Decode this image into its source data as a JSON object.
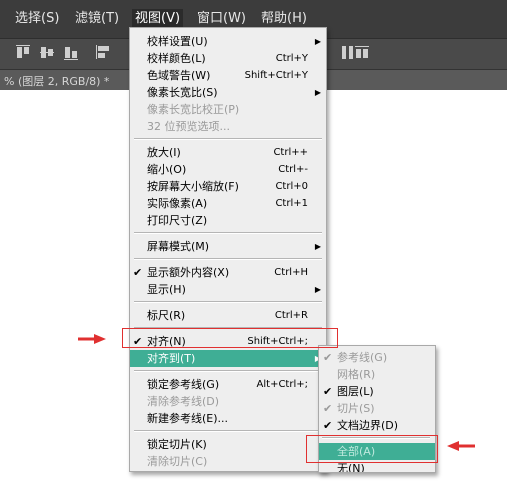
{
  "menubar": {
    "items": [
      {
        "label": "选择(S)"
      },
      {
        "label": "滤镜(T)"
      },
      {
        "label": "视图(V)"
      },
      {
        "label": "窗口(W)"
      },
      {
        "label": "帮助(H)"
      }
    ]
  },
  "document": {
    "tab_title": "% (图层 2, RGB/8) *"
  },
  "view_menu": {
    "items": [
      {
        "label": "校样设置(U)",
        "shortcut": "",
        "submenu": true
      },
      {
        "label": "校样颜色(L)",
        "shortcut": "Ctrl+Y"
      },
      {
        "label": "色域警告(W)",
        "shortcut": "Shift+Ctrl+Y"
      },
      {
        "label": "像素长宽比(S)",
        "shortcut": "",
        "submenu": true
      },
      {
        "label": "像素长宽比校正(P)",
        "shortcut": "",
        "disabled": true
      },
      {
        "label": "32 位预览选项...",
        "shortcut": "",
        "disabled": true
      },
      {
        "label": "放大(I)",
        "shortcut": "Ctrl++"
      },
      {
        "label": "缩小(O)",
        "shortcut": "Ctrl+-"
      },
      {
        "label": "按屏幕大小缩放(F)",
        "shortcut": "Ctrl+0"
      },
      {
        "label": "实际像素(A)",
        "shortcut": "Ctrl+1"
      },
      {
        "label": "打印尺寸(Z)",
        "shortcut": ""
      },
      {
        "label": "屏幕模式(M)",
        "shortcut": "",
        "submenu": true
      },
      {
        "label": "显示额外内容(X)",
        "shortcut": "Ctrl+H",
        "checked": true
      },
      {
        "label": "显示(H)",
        "shortcut": "",
        "submenu": true
      },
      {
        "label": "标尺(R)",
        "shortcut": "Ctrl+R"
      },
      {
        "label": "对齐(N)",
        "shortcut": "Shift+Ctrl+;",
        "checked": true
      },
      {
        "label": "对齐到(T)",
        "shortcut": "",
        "submenu": true,
        "highlighted": true
      },
      {
        "label": "锁定参考线(G)",
        "shortcut": "Alt+Ctrl+;"
      },
      {
        "label": "清除参考线(D)",
        "shortcut": "",
        "disabled": true
      },
      {
        "label": "新建参考线(E)...",
        "shortcut": ""
      },
      {
        "label": "锁定切片(K)",
        "shortcut": ""
      },
      {
        "label": "清除切片(C)",
        "shortcut": "",
        "disabled": true
      }
    ]
  },
  "snap_to_submenu": {
    "items": [
      {
        "label": "参考线(G)",
        "checked": true,
        "disabled": true
      },
      {
        "label": "网格(R)",
        "checked": false,
        "disabled": true
      },
      {
        "label": "图层(L)",
        "checked": true,
        "disabled": false
      },
      {
        "label": "切片(S)",
        "checked": true,
        "disabled": true
      },
      {
        "label": "文档边界(D)",
        "checked": true,
        "disabled": false
      },
      {
        "label": "全部(A)",
        "highlighted": true
      },
      {
        "label": "无(N)"
      }
    ]
  },
  "check_glyph": "✔",
  "submenu_arrow_glyph": "▶",
  "colors": {
    "highlight": "#3fae95",
    "annotation_red": "#e03030",
    "menubar_bg": "#3c3c3c"
  }
}
